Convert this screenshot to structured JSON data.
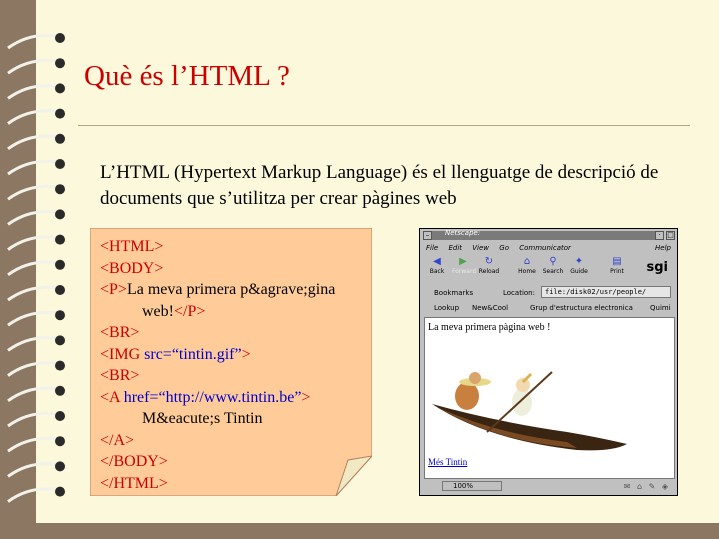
{
  "slide": {
    "title": "Què és l’HTML ?",
    "description": "L’HTML (Hypertext Markup Language) és el llenguatge de descripció de documents que s’utilitza per crear pàgines web"
  },
  "code": {
    "html_open": "<HTML>",
    "body_open": "<BODY>",
    "p_open": "<P>",
    "p_text": "La meva primera p&agrave;gina",
    "p_text2": "web!",
    "p_close": "</P>",
    "br1": "<BR>",
    "img_tag": "<IMG",
    "img_attr": "src=“tintin.gif”",
    "img_end": ">",
    "br2": "<BR>",
    "a_tag": "<A",
    "a_attr": "href=“http://www.tintin.be”",
    "a_end": ">",
    "a_text": "M&eacute;s Tintin",
    "a_close": "</A>",
    "body_close": "</BODY>",
    "html_close": "</HTML>"
  },
  "browser": {
    "window_title": "Netscape:",
    "menu": [
      "File",
      "Edit",
      "View",
      "Go",
      "Communicator"
    ],
    "help": "Help",
    "toolbar": [
      {
        "label": "Back",
        "icon": "back-arrow-icon",
        "glyph": "◀"
      },
      {
        "label": "Forward",
        "icon": "forward-arrow-icon",
        "glyph": "▶"
      },
      {
        "label": "Reload",
        "icon": "reload-icon",
        "glyph": "↻"
      },
      {
        "label": "Home",
        "icon": "home-icon",
        "glyph": "⌂"
      },
      {
        "label": "Search",
        "icon": "search-icon",
        "glyph": "⚲"
      },
      {
        "label": "Guide",
        "icon": "guide-icon",
        "glyph": "✦"
      },
      {
        "label": "Print",
        "icon": "print-icon",
        "glyph": "▤"
      }
    ],
    "brand": "sgi",
    "bookmarks_label": "Bookmarks",
    "location_label": "Location:",
    "location_value": "file:/disk02/usr/people/",
    "personal_links": [
      "Lookup",
      "New&Cool",
      "Grup d'estructura electronica",
      "Quimi"
    ],
    "page_heading": "La meva primera pàgina web !",
    "page_link": "Més Tintin",
    "status_percent": "100%"
  },
  "colors": {
    "background": "#8c7862",
    "page": "#fbf8dc",
    "title": "#cc0000",
    "note": "#ffcc99",
    "tag": "#cc0000",
    "attr": "#0000cc"
  }
}
